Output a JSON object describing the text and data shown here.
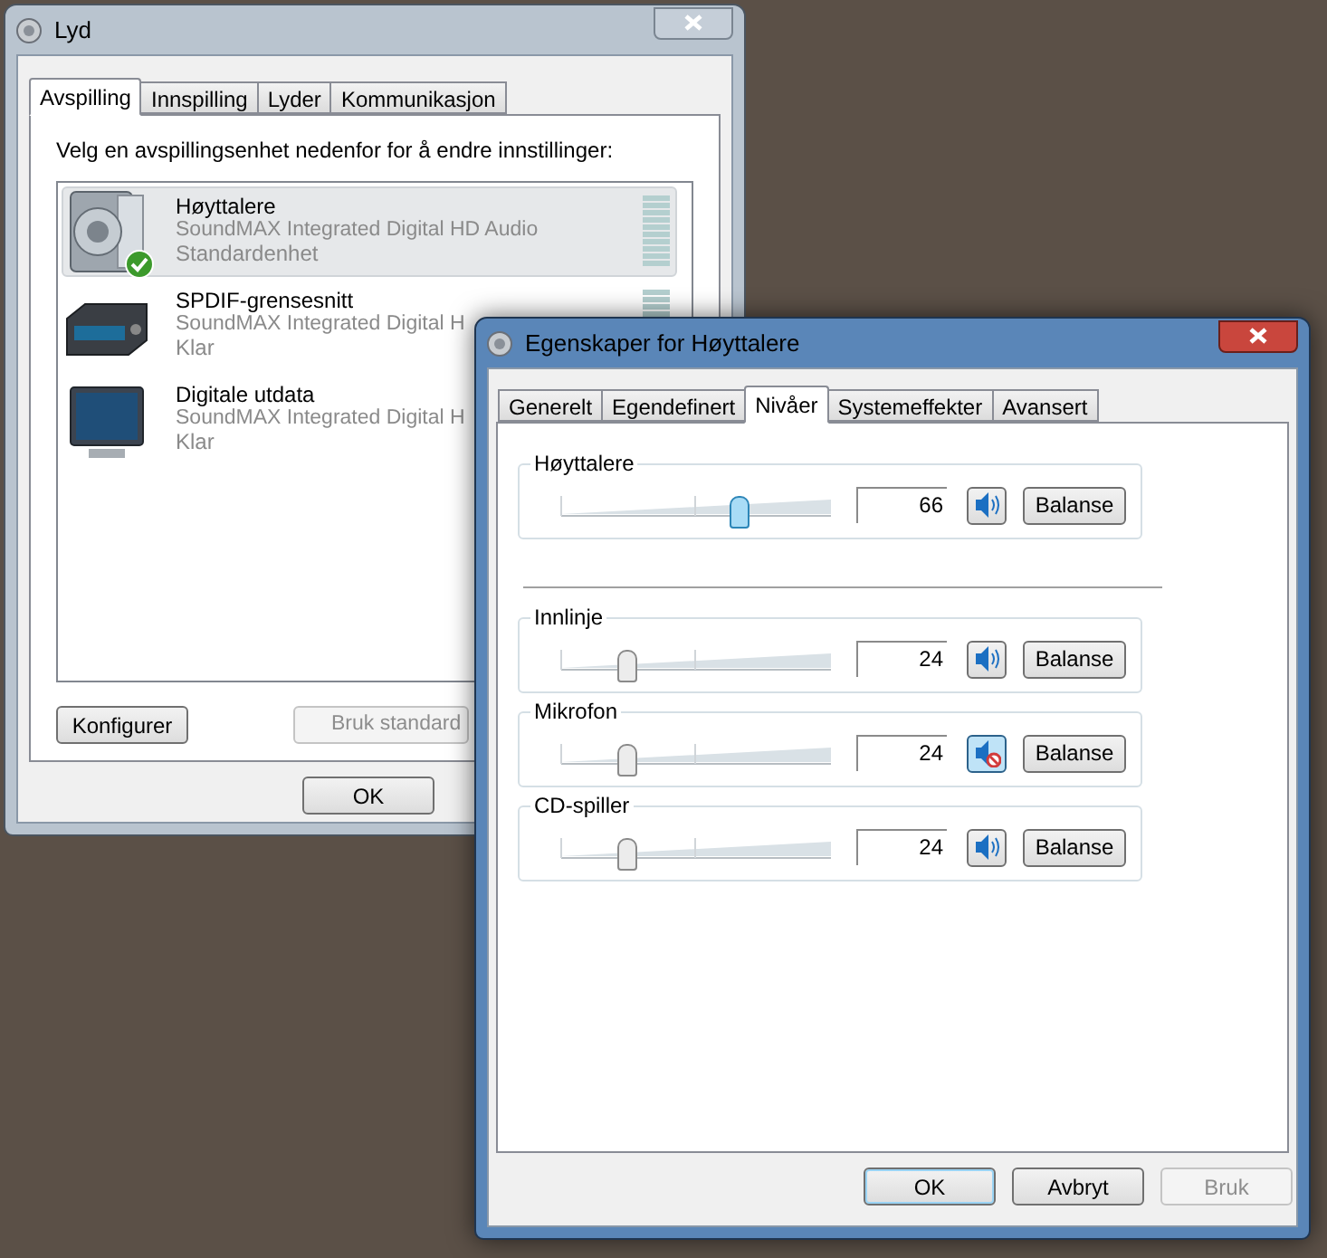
{
  "sound_window": {
    "title": "Lyd",
    "active": false,
    "tabs": [
      {
        "label": "Avspilling",
        "selected": true
      },
      {
        "label": "Innspilling",
        "selected": false
      },
      {
        "label": "Lyder",
        "selected": false
      },
      {
        "label": "Kommunikasjon",
        "selected": false
      }
    ],
    "instruction": "Velg en avspillingsenhet nedenfor for å endre innstillinger:",
    "devices": [
      {
        "kind": "speakers",
        "name": "Høyttalere",
        "description": "SoundMAX Integrated Digital HD Audio",
        "status": "Standardenhet",
        "selected": true,
        "default": true
      },
      {
        "kind": "spdif",
        "name": "SPDIF-grensesnitt",
        "description": "SoundMAX Integrated Digital H",
        "status": "Klar",
        "selected": false,
        "default": false
      },
      {
        "kind": "monitor",
        "name": "Digitale utdata",
        "description": "SoundMAX Integrated Digital H",
        "status": "Klar",
        "selected": false,
        "default": false
      }
    ],
    "buttons": [
      {
        "label": "Konfigurer",
        "disabled": false
      },
      {
        "label": "Bruk standard",
        "disabled": true
      }
    ],
    "footer_buttons": [
      {
        "label": "OK",
        "disabled": false
      }
    ]
  },
  "properties_window": {
    "title": "Egenskaper for Høyttalere",
    "active": true,
    "tabs": [
      {
        "label": "Generelt",
        "selected": false
      },
      {
        "label": "Egendefinert",
        "selected": false
      },
      {
        "label": "Nivåer",
        "selected": true
      },
      {
        "label": "Systemeffekter",
        "selected": false
      },
      {
        "label": "Avansert",
        "selected": false
      }
    ],
    "channels": [
      {
        "kind": "master",
        "name": "Høyttalere",
        "level": 0.66,
        "value": "66",
        "muted": false,
        "focused": true,
        "balance_label": "Balanse"
      },
      {
        "kind": "input",
        "name": "Innlinje",
        "level": 0.24,
        "value": "24",
        "muted": false,
        "focused": false,
        "balance_label": "Balanse"
      },
      {
        "kind": "input",
        "name": "Mikrofon",
        "level": 0.24,
        "value": "24",
        "muted": true,
        "focused": false,
        "balance_label": "Balanse"
      },
      {
        "kind": "input",
        "name": "CD-spiller",
        "level": 0.24,
        "value": "24",
        "muted": false,
        "focused": false,
        "balance_label": "Balanse"
      }
    ],
    "buttons": [
      {
        "label": "OK",
        "kind": "default",
        "disabled": false
      },
      {
        "label": "Avbryt",
        "kind": "normal",
        "disabled": false
      },
      {
        "label": "Bruk",
        "kind": "normal",
        "disabled": true
      }
    ]
  }
}
